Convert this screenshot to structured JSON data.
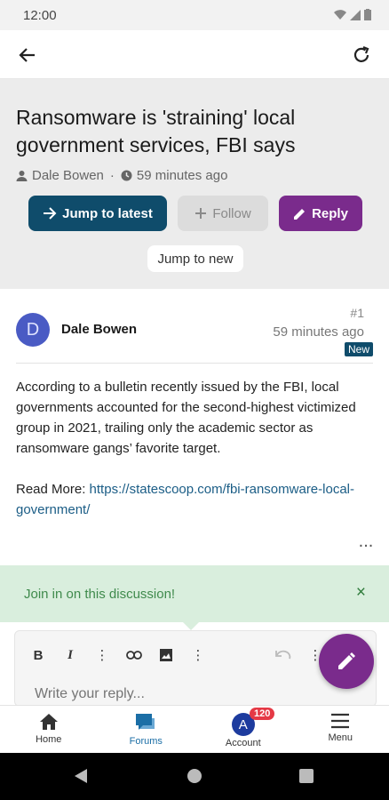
{
  "status_bar": {
    "time": "12:00"
  },
  "topic": {
    "title": "Ransomware is 'straining' local government services, FBI says",
    "author": "Dale Bowen",
    "time_ago": "59 minutes ago",
    "buttons": {
      "jump_latest": "Jump to latest",
      "follow": "Follow",
      "reply": "Reply",
      "jump_new": "Jump to new"
    }
  },
  "post": {
    "avatar_letter": "D",
    "author": "Dale Bowen",
    "number": "#1",
    "time": "59 minutes ago",
    "badge": "New",
    "body": "According to a bulletin recently issued by the FBI, local governments accounted for the second-highest victimized group in 2021, trailing only the academic sector as ransomware gangs’ favorite target.",
    "read_more_label": "Read More: ",
    "link": "https://statescoop.com/fbi-ransomware-local-government/"
  },
  "banner": {
    "text": "Join in on this discussion!",
    "close": "×"
  },
  "composer": {
    "placeholder": "Write your reply..."
  },
  "bottom_nav": {
    "home": "Home",
    "forums": "Forums",
    "account": "Account",
    "account_avatar": "A",
    "account_badge": "120",
    "menu": "Menu"
  },
  "colors": {
    "primary": "#0f4c6b",
    "accent": "#7a2b8c",
    "success_bg": "#d9eedd"
  }
}
